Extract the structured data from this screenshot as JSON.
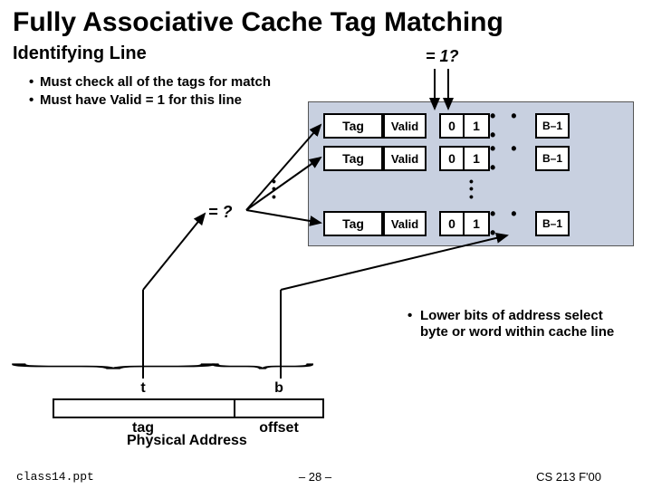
{
  "title": "Fully Associative Cache Tag Matching",
  "subtitle": "Identifying Line",
  "bullets": [
    "Must check all of the tags for match",
    "Must have Valid = 1 for this line"
  ],
  "eq1_label": "= 1?",
  "eqq_label": "= ?",
  "cache": {
    "tag_label": "Tag",
    "valid_label": "Valid",
    "b0": "0",
    "b1": "1",
    "dots": "• • •",
    "bn": "B–1"
  },
  "lower_comment": "Lower bits of address select byte or word within cache line",
  "addr": {
    "t_top": "t",
    "b_top": "b",
    "t_bot": "tag",
    "b_bot": "offset"
  },
  "phys_label": "Physical Address",
  "footer": {
    "file": "class14.ppt",
    "page": "– 28 –",
    "course": "CS 213 F'00"
  }
}
